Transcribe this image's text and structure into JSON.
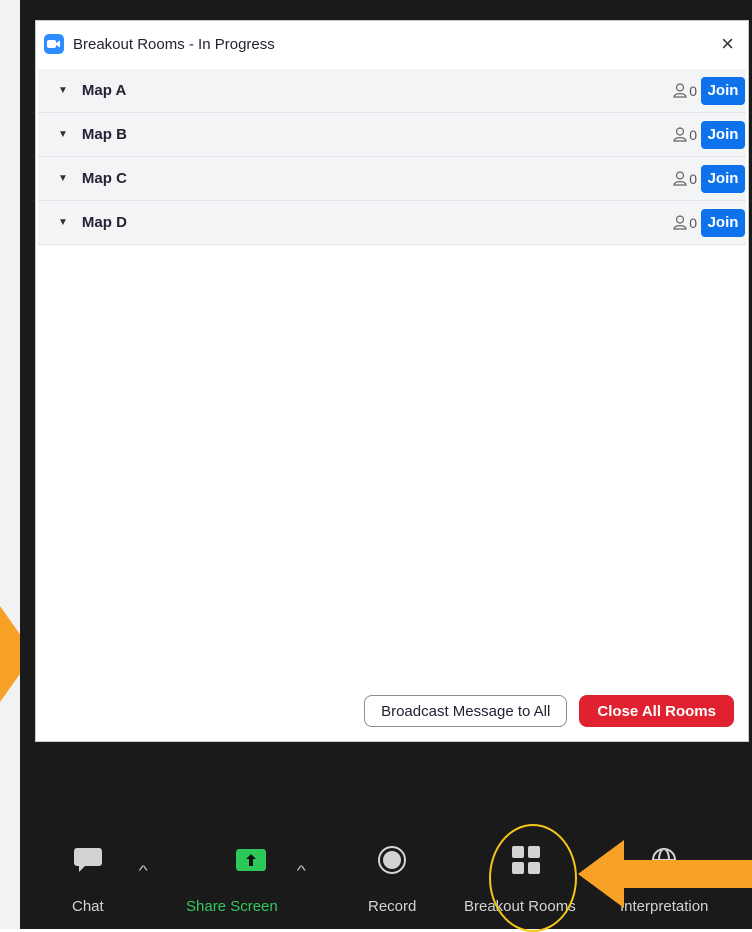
{
  "dialog": {
    "title": "Breakout Rooms - In Progress",
    "close_icon": "×",
    "rooms": [
      {
        "name": "Map A",
        "count": "0",
        "join_label": "Join"
      },
      {
        "name": "Map B",
        "count": "0",
        "join_label": "Join"
      },
      {
        "name": "Map C",
        "count": "0",
        "join_label": "Join"
      },
      {
        "name": "Map D",
        "count": "0",
        "join_label": "Join"
      }
    ],
    "broadcast_label": "Broadcast Message to All",
    "close_all_label": "Close All Rooms"
  },
  "toolbar": {
    "chat_label": "Chat",
    "share_label": "Share Screen",
    "record_label": "Record",
    "breakout_label": "Breakout Rooms",
    "interpretation_label": "Interpretation"
  },
  "colors": {
    "accent_blue": "#0e72ed",
    "danger_red": "#e0212f",
    "share_green": "#35c55f",
    "highlight_yellow": "#f5c518",
    "arrow_orange": "#f7a226"
  },
  "icons": [
    "zoom-logo-icon",
    "close-icon",
    "caret-down-icon",
    "person-icon",
    "chat-icon",
    "share-screen-icon",
    "record-icon",
    "breakout-rooms-icon",
    "globe-icon",
    "caret-up-icon"
  ]
}
